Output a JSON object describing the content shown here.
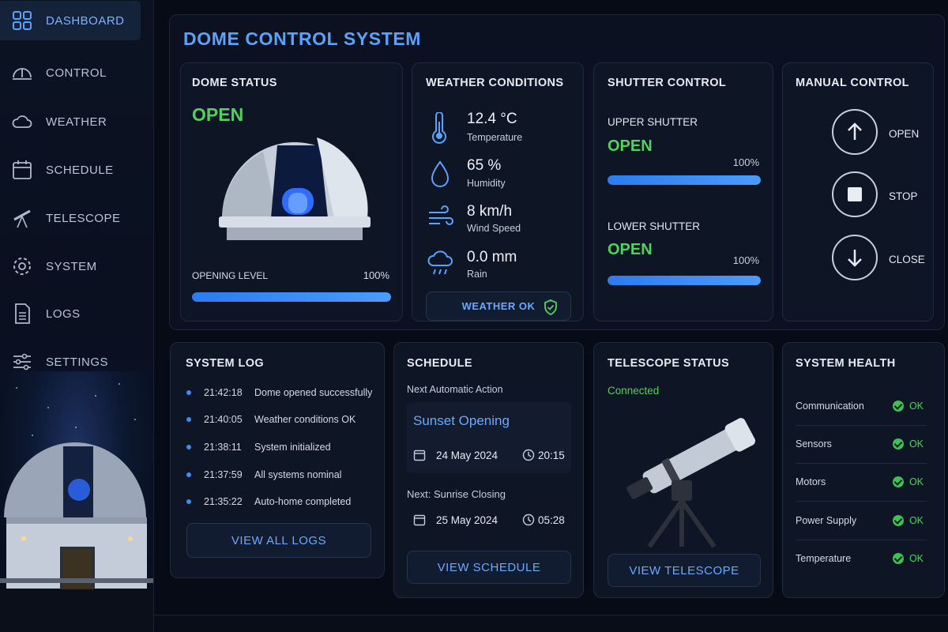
{
  "sidebar": {
    "items": [
      {
        "label": "DASHBOARD",
        "icon": "dashboard-icon"
      },
      {
        "label": "CONTROL",
        "icon": "dome-icon"
      },
      {
        "label": "WEATHER",
        "icon": "cloud-icon"
      },
      {
        "label": "SCHEDULE",
        "icon": "calendar-icon"
      },
      {
        "label": "TELESCOPE",
        "icon": "telescope-icon"
      },
      {
        "label": "SYSTEM",
        "icon": "gear-icon"
      },
      {
        "label": "LOGS",
        "icon": "document-icon"
      },
      {
        "label": "SETTINGS",
        "icon": "sliders-icon"
      }
    ]
  },
  "page": {
    "title": "DOME CONTROL SYSTEM"
  },
  "dome_status": {
    "title": "DOME STATUS",
    "state": "OPEN",
    "opening_label": "OPENING LEVEL",
    "opening_value": "100%",
    "opening_fraction": 1.0
  },
  "weather": {
    "title": "WEATHER CONDITIONS",
    "temperature": {
      "value": "12.4 °C",
      "label": "Temperature"
    },
    "humidity": {
      "value": "65 %",
      "label": "Humidity"
    },
    "wind": {
      "value": "8 km/h",
      "label": "Wind Speed"
    },
    "rain": {
      "value": "0.0 mm",
      "label": "Rain"
    },
    "status": "WEATHER OK"
  },
  "shutter": {
    "title": "SHUTTER CONTROL",
    "upper": {
      "label": "UPPER SHUTTER",
      "state": "OPEN",
      "value": "100%",
      "fraction": 1.0
    },
    "lower": {
      "label": "LOWER SHUTTER",
      "state": "OPEN",
      "value": "100%",
      "fraction": 1.0
    }
  },
  "manual": {
    "title": "MANUAL CONTROL",
    "open": "OPEN",
    "stop": "STOP",
    "close": "CLOSE"
  },
  "system_log": {
    "title": "SYSTEM LOG",
    "entries": [
      {
        "time": "21:42:18",
        "message": "Dome opened successfully"
      },
      {
        "time": "21:40:05",
        "message": "Weather conditions OK"
      },
      {
        "time": "21:38:11",
        "message": "System initialized"
      },
      {
        "time": "21:37:59",
        "message": "All systems nominal"
      },
      {
        "time": "21:35:22",
        "message": "Auto-home completed"
      }
    ],
    "button": "VIEW ALL LOGS"
  },
  "schedule": {
    "title": "SCHEDULE",
    "next_label": "Next Automatic Action",
    "next_action": "Sunset Opening",
    "next_date": "24 May 2024",
    "next_time": "20:15",
    "following_label": "Next: Sunrise Closing",
    "following_date": "25 May 2024",
    "following_time": "05:28",
    "button": "VIEW SCHEDULE"
  },
  "telescope": {
    "title": "TELESCOPE STATUS",
    "state": "Connected",
    "button": "VIEW TELESCOPE"
  },
  "health": {
    "title": "SYSTEM HEALTH",
    "items": [
      {
        "label": "Communication",
        "status": "OK"
      },
      {
        "label": "Sensors",
        "status": "OK"
      },
      {
        "label": "Motors",
        "status": "OK"
      },
      {
        "label": "Power Supply",
        "status": "OK"
      },
      {
        "label": "Temperature",
        "status": "OK"
      }
    ]
  },
  "colors": {
    "accent": "#4c9bff",
    "ok_green": "#4fd35b",
    "background": "#060b16"
  }
}
